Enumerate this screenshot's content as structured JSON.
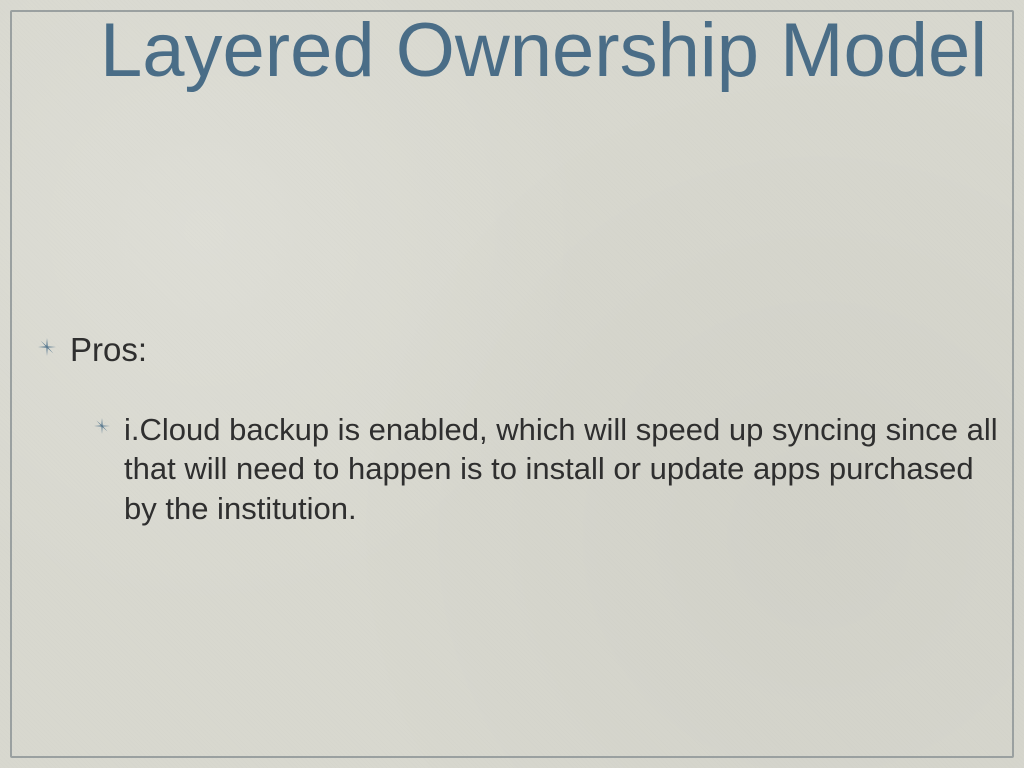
{
  "slide": {
    "title": "Layered Ownership Model",
    "level1": {
      "label": "Pros:"
    },
    "level2": {
      "text": "i.Cloud backup is enabled, which will speed up syncing since all that will need to happen is to install or update apps purchased by the institution."
    }
  },
  "colors": {
    "title": "#4a6d87",
    "body": "#2f2f2f",
    "bullet": "#5a7a90",
    "border": "#9aa0a0",
    "background": "#d8d8cf"
  }
}
